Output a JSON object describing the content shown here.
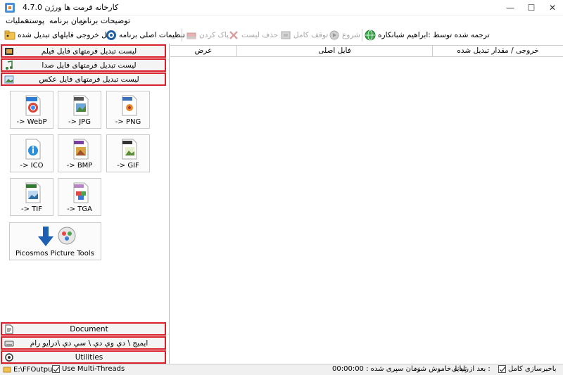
{
  "window": {
    "title": "کارخانه فرمت ها ورژن 4.7.0",
    "minimize": "—",
    "maximize": "☐",
    "close": "✕"
  },
  "menu": {
    "items": [
      "توضیحات برنامه",
      "زبان برنامه",
      "پوسته",
      "عملیات"
    ]
  },
  "toolbar": {
    "output_folder": "محل خروجی فایلهای تبدیل شده",
    "settings": "تنظیمات اصلی برنامه",
    "clear": "پاک کردن",
    "remove_list": "حذف لیست",
    "stop_all": "توقف کامل",
    "start": "شروع",
    "translated_by": "ترجمه شده توسط :ابراهیم شبانکاره"
  },
  "categories": {
    "video": "لیست تبدیل فرمتهای فایل  فیلم",
    "audio": "لیست تبدیل فرمتهای فایل  صدا",
    "picture": "لیست تبدیل فرمتهای فایل  عکس",
    "document": "Document",
    "rom": "ایمیج \\ دي وي دي \\ سي دي \\درايو رام",
    "utilities": "Utilities"
  },
  "formats": [
    {
      "label": "-> WebP",
      "badge": "WebP",
      "color": "#2e7bd6"
    },
    {
      "label": "-> JPG",
      "badge": "JPG",
      "color": "#555555"
    },
    {
      "label": "-> PNG",
      "badge": "PNG",
      "color": "#3a6fb8"
    },
    {
      "label": "-> ICO",
      "badge": "",
      "color": "#2b8fd9"
    },
    {
      "label": "-> BMP",
      "badge": "BMP",
      "color": "#7a3da0"
    },
    {
      "label": "-> GIF",
      "badge": "GIF",
      "color": "#333333"
    },
    {
      "label": "-> TIF",
      "badge": "TIFF",
      "color": "#2f7a2f"
    },
    {
      "label": "-> TGA",
      "badge": "TGA",
      "color": "#b784c7"
    }
  ],
  "picture_tools": "Picosmos Picture Tools",
  "table": {
    "columns": [
      "خروجی / مقدار تبدیل شده",
      "فایل اصلی",
      "عرض"
    ]
  },
  "status": {
    "output_path": "E:\\FFOutput",
    "multithread": "Use Multi-Threads",
    "multithread_checked": true,
    "elapsed": "زمان سپری شده : 00:00:00",
    "shutdown": "رایانه خاموش شود",
    "after_convert": "بعد از تبدیل :",
    "notify": "باخبرسازی کامل",
    "notify_checked": true
  }
}
